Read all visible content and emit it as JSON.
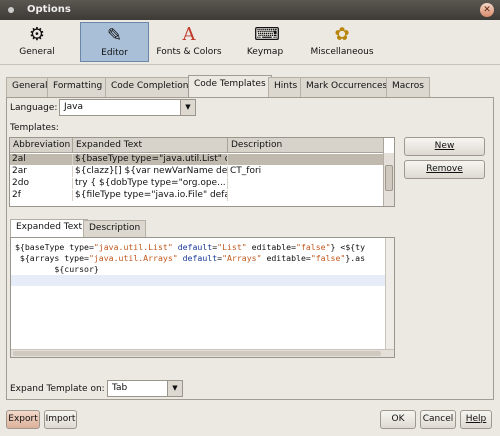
{
  "window": {
    "title": "Options"
  },
  "categories": [
    {
      "label": "General",
      "icon": "wrench-gears-icon",
      "glyph": "⚙",
      "selected": false
    },
    {
      "label": "Editor",
      "icon": "editor-icon",
      "glyph": "✎",
      "selected": true
    },
    {
      "label": "Fonts & Colors",
      "icon": "fonts-colors-icon",
      "glyph": "A",
      "selected": false
    },
    {
      "label": "Keymap",
      "icon": "keymap-icon",
      "glyph": "⌨",
      "selected": false
    },
    {
      "label": "Miscellaneous",
      "icon": "miscellaneous-icon",
      "glyph": "✿",
      "selected": false
    }
  ],
  "tabs": [
    {
      "label": "General"
    },
    {
      "label": "Formatting"
    },
    {
      "label": "Code Completion"
    },
    {
      "label": "Code Templates",
      "selected": true
    },
    {
      "label": "Hints"
    },
    {
      "label": "Mark Occurrences"
    },
    {
      "label": "Macros"
    }
  ],
  "language": {
    "label": "Language:",
    "value": "Java"
  },
  "templates": {
    "label": "Templates:",
    "columns": [
      "Abbreviation",
      "Expanded Text",
      "Description"
    ],
    "rows": [
      [
        "2al",
        "${baseType type=\"java.util.List\" d...",
        ""
      ],
      [
        "2ar",
        "${clazz}[] ${var newVarName de...",
        "CT_fori"
      ],
      [
        "2do",
        "try {   ${dobType type=\"org.ope...",
        ""
      ],
      [
        "2f",
        "${fileType type=\"java.io.File\" defa...",
        ""
      ]
    ],
    "selected_row": 0
  },
  "buttons": {
    "new": "New",
    "remove": "Remove",
    "export": "Export",
    "import": "Import",
    "ok": "OK",
    "cancel": "Cancel",
    "help": "Help"
  },
  "subtabs": [
    {
      "label": "Expanded Text",
      "selected": true
    },
    {
      "label": "Description"
    }
  ],
  "code": {
    "line1": [
      {
        "t": "${baseType type=",
        "c": ""
      },
      {
        "t": "\"java.util.List\"",
        "c": "s"
      },
      {
        "t": " ",
        "c": ""
      },
      {
        "t": "default",
        "c": "k"
      },
      {
        "t": "=",
        "c": ""
      },
      {
        "t": "\"List\"",
        "c": "s"
      },
      {
        "t": " editable=",
        "c": ""
      },
      {
        "t": "\"false\"",
        "c": "s"
      },
      {
        "t": "} <${ty",
        "c": ""
      }
    ],
    "line2": [
      {
        "t": " ${arrays type=",
        "c": ""
      },
      {
        "t": "\"java.util.Arrays\"",
        "c": "s"
      },
      {
        "t": " ",
        "c": ""
      },
      {
        "t": "default",
        "c": "k"
      },
      {
        "t": "=",
        "c": ""
      },
      {
        "t": "\"Arrays\"",
        "c": "s"
      },
      {
        "t": " editable=",
        "c": ""
      },
      {
        "t": "\"false\"",
        "c": "s"
      },
      {
        "t": "}.as",
        "c": ""
      }
    ],
    "line3": "        ${cursor}"
  },
  "expand_on": {
    "label": "Expand Template on:",
    "value": "Tab"
  }
}
